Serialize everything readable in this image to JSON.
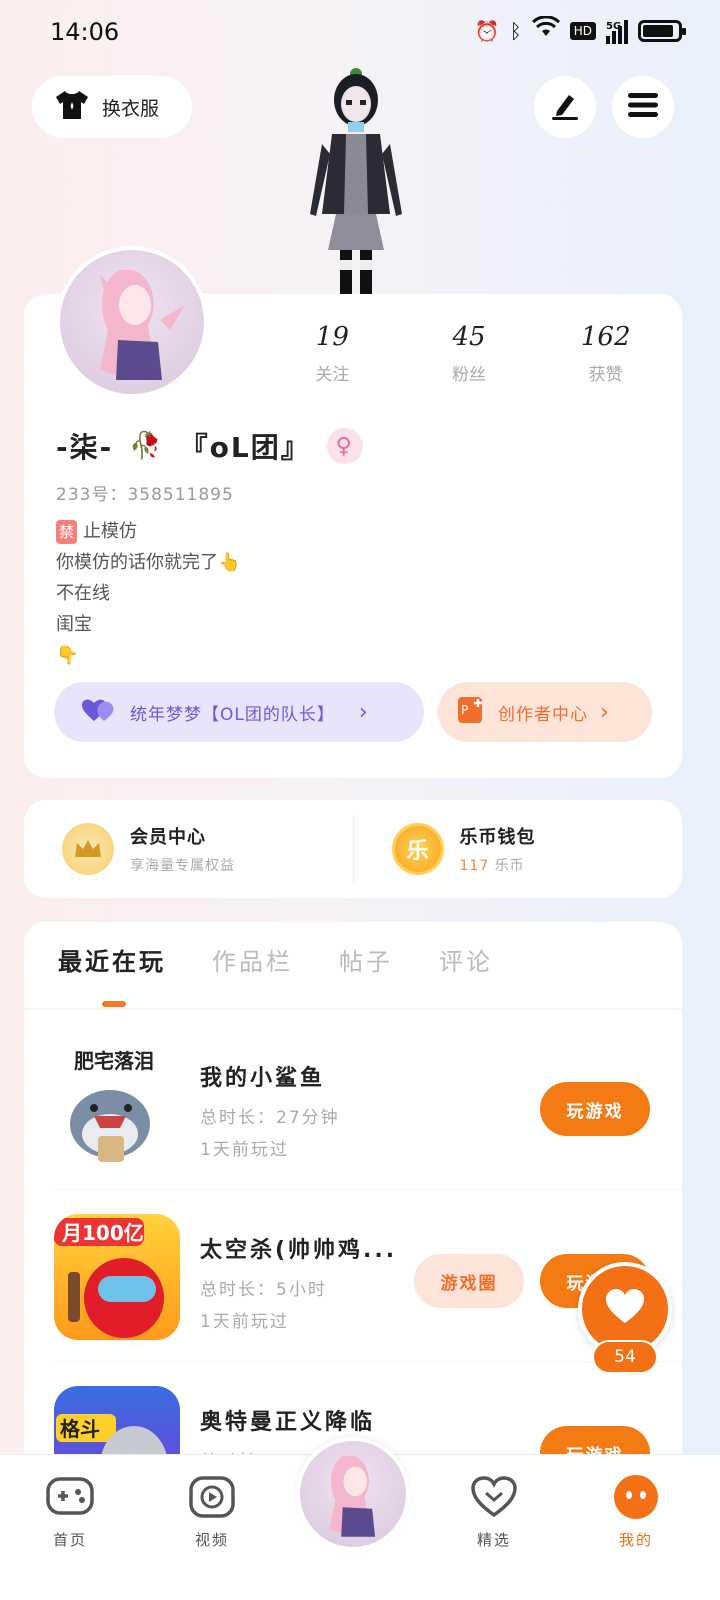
{
  "status_bar": {
    "time": "14:06",
    "hd": "HD",
    "network": "5G"
  },
  "header": {
    "outfit_label": "换衣服",
    "edit_icon": "pen-icon",
    "menu_icon": "menu-icon"
  },
  "profile": {
    "stats": [
      {
        "value": "19",
        "label": "关注"
      },
      {
        "value": "45",
        "label": "粉丝"
      },
      {
        "value": "162",
        "label": "获赞"
      }
    ],
    "nickname_prefix": "-柒-",
    "nickname_suffix": "『oL团』",
    "account_id": "233号：358511895",
    "bio": {
      "ban_tag": "禁",
      "line1_rest": "止模仿",
      "line2": "你模仿的话你就完了👆",
      "line3": "不在线",
      "line4": "闺宝",
      "line5": "👇"
    },
    "friend_label": "统年梦梦【OL团的队长】",
    "creator_label": "创作者中心"
  },
  "wallet": {
    "vip_title": "会员中心",
    "vip_sub": "享海量专属权益",
    "coin_icon_text": "乐",
    "coin_title": "乐币钱包",
    "coin_count": "117",
    "coin_unit": "乐币"
  },
  "tabs": [
    "最近在玩",
    "作品栏",
    "帖子",
    "评论"
  ],
  "games": [
    {
      "name": "我的小鲨鱼",
      "duration": "总时长：27分钟",
      "last_played": "1天前玩过",
      "play_label": "玩游戏",
      "icon_text": "肥宅落泪"
    },
    {
      "name": "太空杀(帅帅鸡...",
      "duration": "总时长：5小时",
      "last_played": "1天前玩过",
      "play_label": "玩游戏",
      "circle_label": "游戏圈",
      "icon_text": "月100亿"
    },
    {
      "name": "奥特曼正义降临",
      "duration": "总时长：",
      "play_label": "玩游戏",
      "icon_text": "格斗"
    }
  ],
  "like_count": "54",
  "bottom_nav": [
    {
      "label": "首页"
    },
    {
      "label": "视频"
    },
    {
      "label": "精选"
    },
    {
      "label": "我的"
    }
  ],
  "colors": {
    "accent": "#f47014",
    "friend_purple": "#6a5ad8",
    "creator_orange": "#f26e2b"
  }
}
